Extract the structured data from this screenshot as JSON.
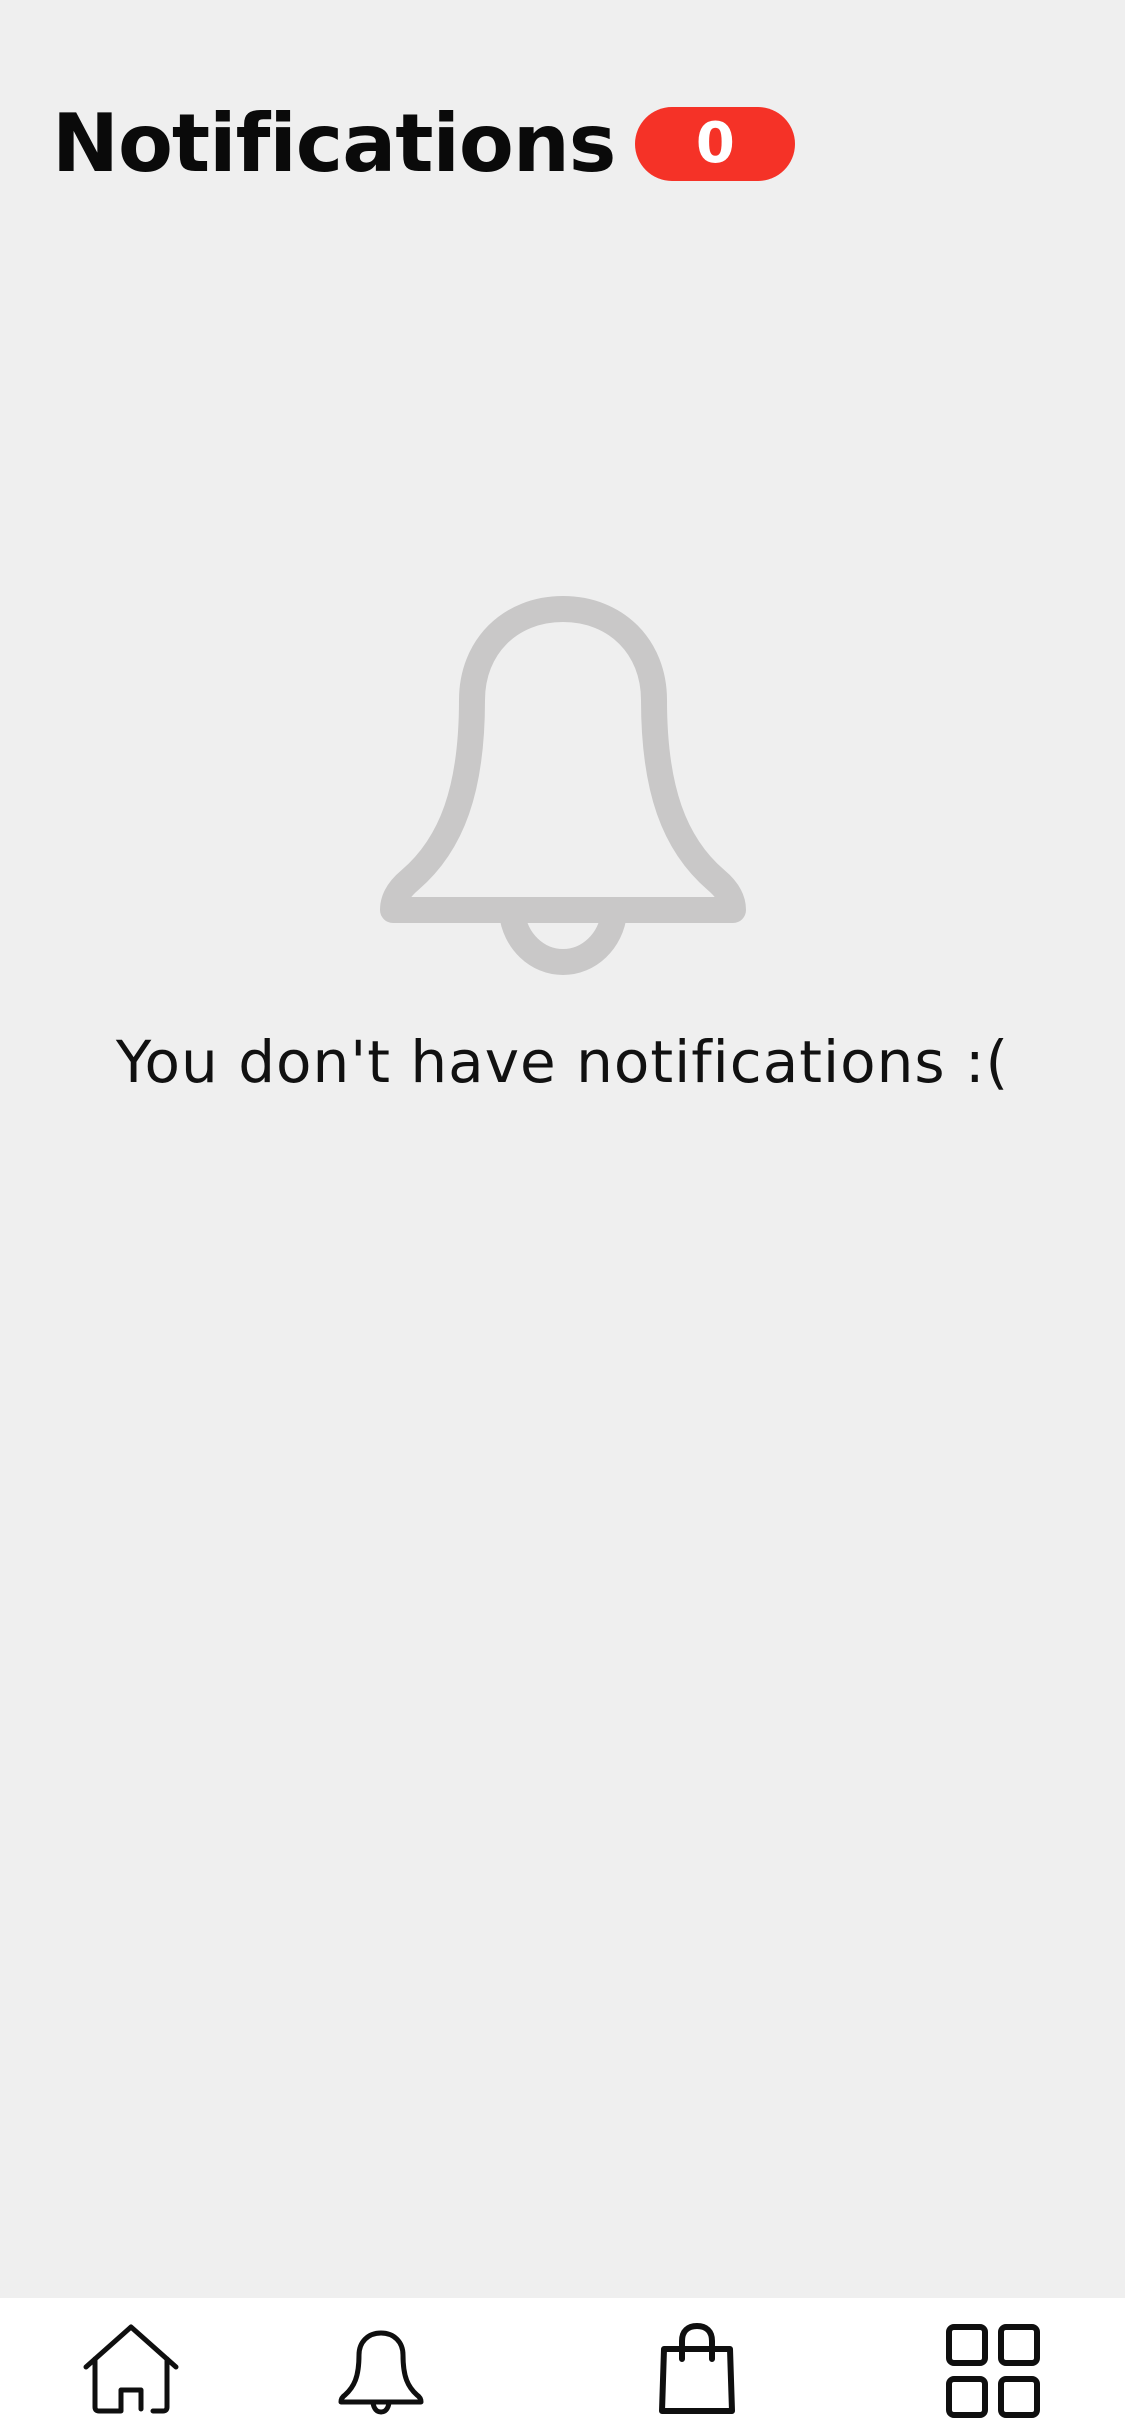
{
  "header": {
    "title": "Notifications",
    "badge_count": "0",
    "badge_color": "#f53227"
  },
  "empty_state": {
    "icon": "bell-icon",
    "icon_color": "#c9c8c8",
    "message": "You don't have notifications :("
  },
  "bottom_nav": {
    "items": [
      {
        "icon": "home-icon"
      },
      {
        "icon": "bell-icon"
      },
      {
        "icon": "shopping-bag-icon"
      },
      {
        "icon": "grid-icon"
      }
    ]
  }
}
